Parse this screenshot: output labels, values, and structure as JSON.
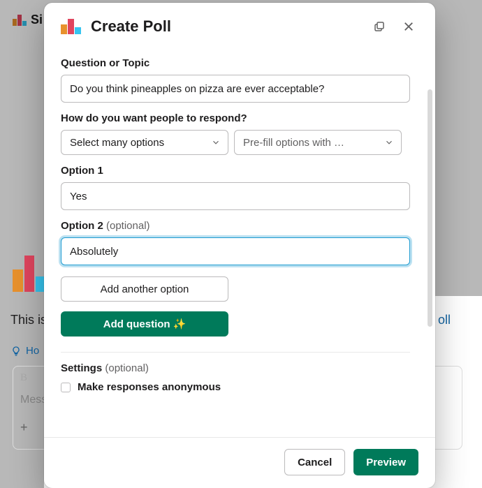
{
  "background": {
    "app_initial": "Si",
    "channel_intro": "This is",
    "link_fragment": "oll",
    "hint_text": "Ho",
    "compose_bold": "B",
    "compose_placeholder": "Mess",
    "compose_plus": "+"
  },
  "modal": {
    "title": "Create Poll",
    "fields": {
      "question_label": "Question or Topic",
      "question_value": "Do you think pineapples on pizza are ever acceptable?",
      "respond_label": "How do you want people to respond?",
      "select_mode": "Select many options",
      "prefill": "Pre-fill options with …",
      "option1_label": "Option 1",
      "option1_value": "Yes",
      "option2_label": "Option 2",
      "option2_optional": "(optional)",
      "option2_value": "Absolutely",
      "add_option": "Add another option",
      "add_question": "Add question",
      "sparkle": "✨"
    },
    "settings": {
      "heading": "Settings",
      "optional": "(optional)",
      "anonymous": "Make responses anonymous"
    },
    "footer": {
      "cancel": "Cancel",
      "preview": "Preview"
    }
  }
}
